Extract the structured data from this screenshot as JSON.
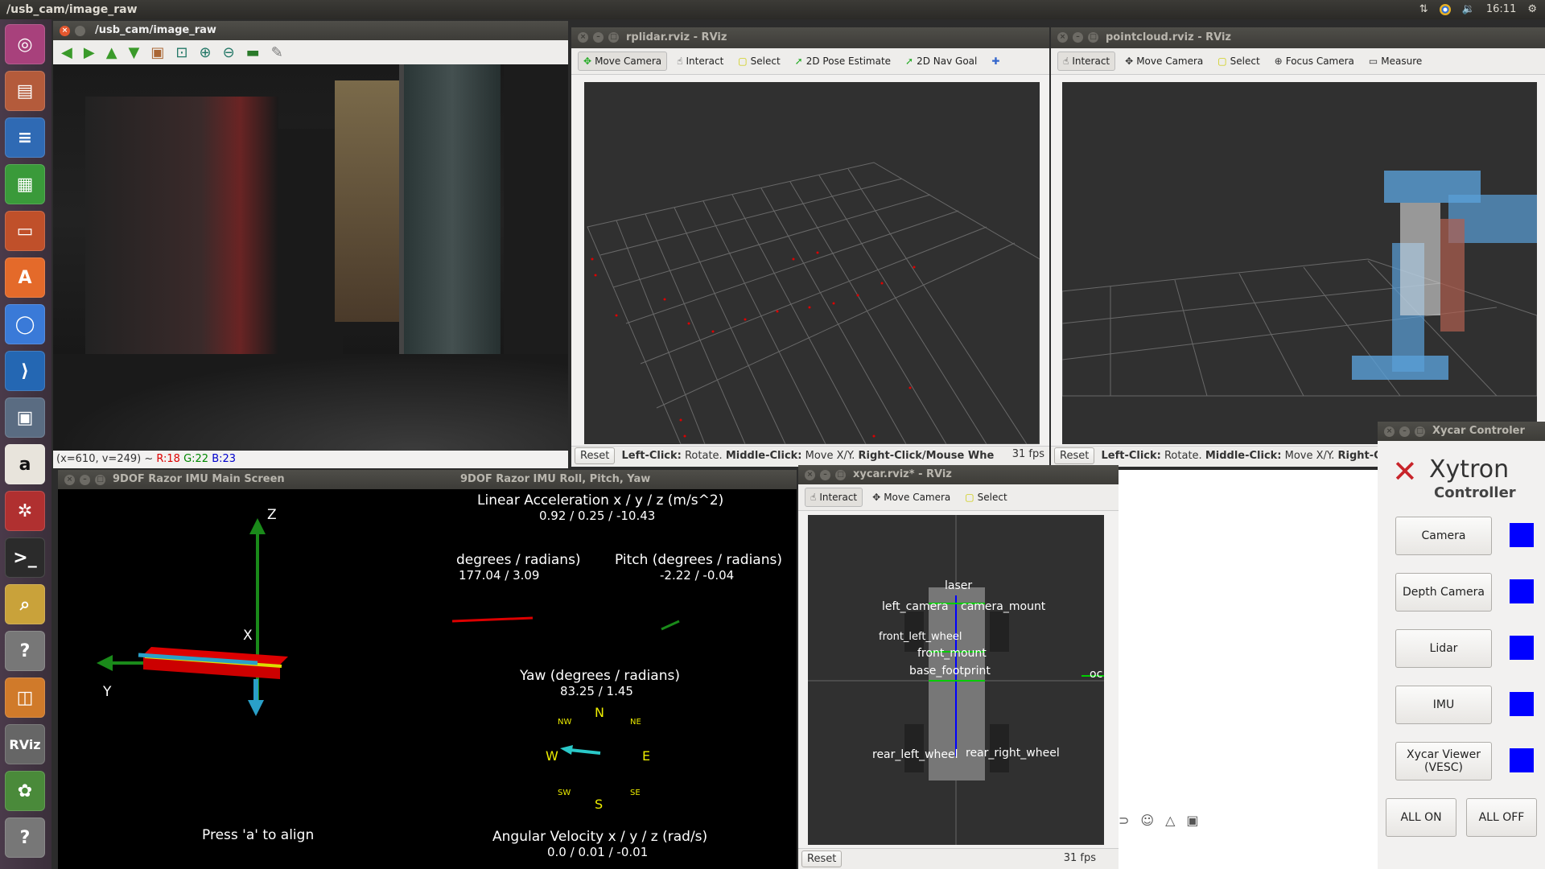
{
  "topbar": {
    "title": "/usb_cam/image_raw",
    "clock": "16:11"
  },
  "camera_window": {
    "title": "/usb_cam/image_raw",
    "status_coords": "(x=610, v=249) ~",
    "status_r": "R:18",
    "status_g": "G:22",
    "status_b": "B:23"
  },
  "rplidar": {
    "title": "rplidar.rviz - RViz",
    "tools": [
      "Move Camera",
      "Interact",
      "Select",
      "2D Pose Estimate",
      "2D Nav Goal"
    ],
    "reset": "Reset",
    "hint_bold1": "Left-Click:",
    "hint1": " Rotate. ",
    "hint_bold2": "Middle-Click:",
    "hint2": " Move X/Y. ",
    "hint_bold3": "Right-Click/Mouse Whe",
    "fps": "31 fps"
  },
  "pointcloud": {
    "title": "pointcloud.rviz - RViz",
    "tools": [
      "Interact",
      "Move Camera",
      "Select",
      "Focus Camera",
      "Measure"
    ],
    "reset": "Reset",
    "hint_bold1": "Left-Click:",
    "hint1": " Rotate. ",
    "hint_bold2": "Middle-Click:",
    "hint2": " Move X/Y. ",
    "hint_bold3": "Right-C"
  },
  "imu": {
    "title": "9DOF Razor IMU Main Screen",
    "title2": "9DOF Razor IMU Roll, Pitch, Yaw",
    "axis_z": "Z",
    "axis_x": "X",
    "axis_y": "Y",
    "lin_acc_label": "Linear Acceleration x / y / z (m/s^2)",
    "lin_acc_value": "0.92 / 0.25 / -10.43",
    "roll_label": "degrees / radians)",
    "roll_value": "177.04 / 3.09",
    "pitch_label": "Pitch (degrees / radians)",
    "pitch_value": "-2.22 / -0.04",
    "yaw_label": "Yaw (degrees / radians)",
    "yaw_value": "83.25 / 1.45",
    "compass": {
      "N": "N",
      "S": "S",
      "E": "E",
      "W": "W",
      "NW": "NW",
      "NE": "NE",
      "SW": "SW",
      "SE": "SE"
    },
    "align_text": "Press 'a' to align",
    "ang_vel_label": "Angular Velocity x / y / z (rad/s)",
    "ang_vel_value": "0.0 / 0.01 / -0.01"
  },
  "xycar_rviz": {
    "title": "xycar.rviz* - RViz",
    "tools": [
      "Interact",
      "Move Camera",
      "Select"
    ],
    "frames": [
      "laser",
      "left_camera",
      "camera_mount",
      "front_left_wheel",
      "front_mount",
      "base_footprint",
      "rear_left_wheel",
      "rear_right_wheel",
      "oc"
    ],
    "reset": "Reset",
    "fps": "31 fps"
  },
  "controller": {
    "title": "Xycar Controler",
    "brand": "Xytron",
    "subtitle": "Controller",
    "buttons": [
      "Camera",
      "Depth Camera",
      "Lidar",
      "IMU",
      "Xycar Viewer (VESC)"
    ],
    "all_on": "ALL ON",
    "all_off": "ALL OFF",
    "indicator_color": "#0000ff"
  },
  "launcher_icons": [
    "ubuntu-icon",
    "files-icon",
    "writer-icon",
    "calc-icon",
    "impress-icon",
    "software-center-icon",
    "chromium-icon",
    "vscode-icon",
    "remote-desktop-icon",
    "amazon-icon",
    "settings-icon",
    "terminal-icon",
    "image-viewer-icon",
    "help-icon",
    "box-icon",
    "rviz-icon",
    "rqt-icon",
    "help-icon"
  ]
}
